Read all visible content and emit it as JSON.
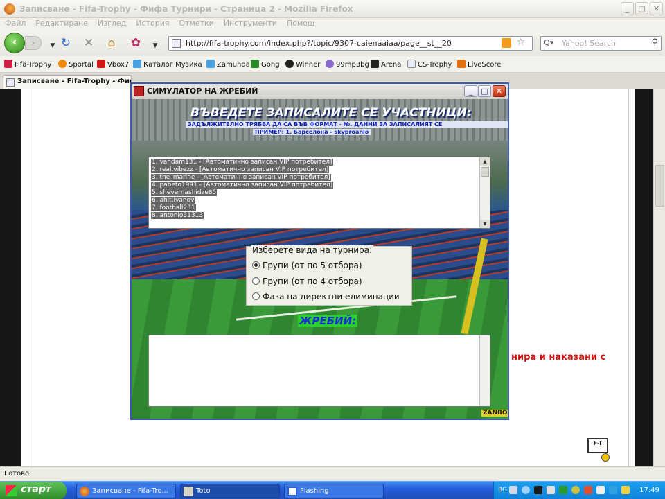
{
  "browser": {
    "title": "Записване - Fifa-Trophy - Фифа Турнири - Страница 2 - Mozilla Firefox",
    "menu": [
      "Файл",
      "Редактиране",
      "Изглед",
      "История",
      "Отметки",
      "Инструменти",
      "Помощ"
    ],
    "url": "http://fifa-trophy.com/index.php?/topic/9307-caienaaiaa/page__st__20",
    "search_placeholder": "Yahoo! Search",
    "bookmarks": [
      "Fifa-Trophy",
      "Sportal",
      "Vbox7",
      "Каталог Музика",
      "Zamunda",
      "Gong",
      "Winner",
      "99mp3bg",
      "Arena",
      "CS-Trophy",
      "LiveScore"
    ],
    "tab_label": "Записване - Fifa-Trophy - Фифа",
    "status": "Готово"
  },
  "page": {
    "red_text": "нира и наказани с",
    "logo_text": "F-T"
  },
  "simulator": {
    "title": "СИМУЛАТОР НА ЖРЕБИЙ",
    "heading": "ВЪВЕДЕТЕ ЗАПИСАЛИТЕ СЕ УЧАСТНИЦИ:",
    "instruction": "ЗАДЪЛЖИТЕЛНО ТРЯБВА ДА СА ВЪВ ФОРМАТ - №. ДАННИ ЗА ЗАПИСАЛИЯТ СЕ",
    "example": "ПРИМЕР: 1. Барселона - skyproanio",
    "participants": [
      "1. vandam131 - [Автоматично записан VIP потребител]",
      "2. real.vibezz - [Автоматично записан VIP потребител]",
      "3. the_marine - [Автоматично записан VIP потребител]",
      "4. pabeto1991 - [Автоматично записан VIP потребител]",
      "5. shevernashidze85",
      "6. ahit.ivanov",
      "7. football231",
      "8. antonio31313"
    ],
    "tournament_legend": "Изберете вида на турнира:",
    "options": [
      "Групи (от по 5 отбора)",
      "Групи (от по 4 отбора)",
      "Фаза на директни елиминации"
    ],
    "selected_option": 0,
    "draw_label": "ЖРЕБИЙ:",
    "brand": "ZANBO"
  },
  "taskbar": {
    "start": "старт",
    "items": [
      "Записване - Fifa-Tro...",
      "Toto",
      "Flashing"
    ],
    "lang": "BG",
    "clock": "17:49"
  }
}
